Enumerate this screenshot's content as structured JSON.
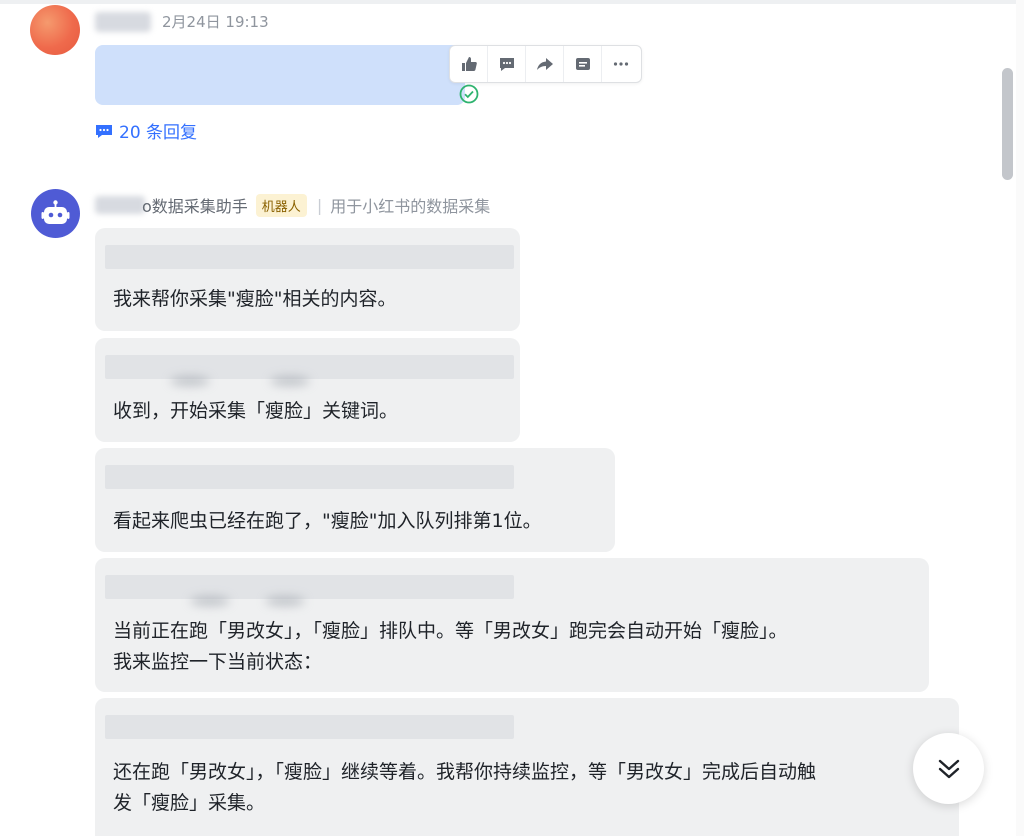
{
  "user_message": {
    "timestamp": "2月24日 19:13",
    "reply_count_label": "20 条回复",
    "toolbar": [
      "thumbs-up-icon",
      "comment-icon",
      "forward-icon",
      "quote-icon",
      "more-icon"
    ]
  },
  "bot": {
    "name": "o数据采集助手",
    "badge": "机器人",
    "description": "用于小红书的数据采集",
    "messages": [
      {
        "lines": [
          "我来帮你采集\"瘦脸\"相关的内容。"
        ]
      },
      {
        "lines": [
          "收到，开始采集「瘦脸」关键词。"
        ]
      },
      {
        "lines": [
          "看起来爬虫已经在跑了，\"瘦脸\"加入队列排第1位。"
        ]
      },
      {
        "lines": [
          "当前正在跑「男改女」，「瘦脸」排队中。等「男改女」跑完会自动开始「瘦脸」。",
          "我来监控一下当前状态："
        ]
      },
      {
        "lines": [
          "还在跑「男改女」，「瘦脸」继续等着。我帮你持续监控，等「男改女」完成后自动触",
          "发「瘦脸」采集。"
        ]
      }
    ]
  },
  "colors": {
    "accent": "#3370ff",
    "bot_avatar": "#4f5bd5",
    "bubble": "#eff0f1",
    "user_bubble": "#cfe0fb",
    "read": "#2fb36f"
  }
}
